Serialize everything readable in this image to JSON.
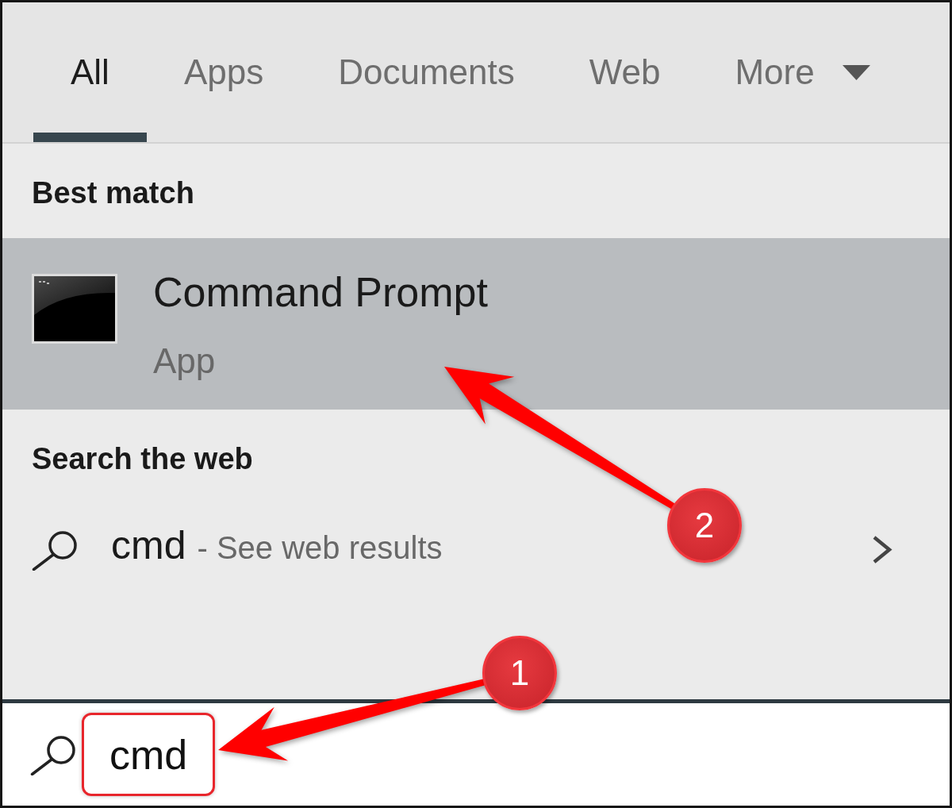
{
  "tabs": [
    {
      "label": "All",
      "selected": true
    },
    {
      "label": "Apps",
      "selected": false
    },
    {
      "label": "Documents",
      "selected": false
    },
    {
      "label": "Web",
      "selected": false
    },
    {
      "label": "More",
      "selected": false,
      "dropdown": true
    }
  ],
  "sections": [
    {
      "heading": "Best match",
      "results": [
        {
          "kind": "app",
          "title": "Command Prompt",
          "subtitle": "App",
          "selected": true,
          "callout": "2"
        }
      ]
    },
    {
      "heading": "Search the web",
      "results": [
        {
          "kind": "web",
          "query": "cmd",
          "hint": "- See web results",
          "selected": false
        }
      ]
    }
  ],
  "search_box": {
    "value": "cmd",
    "highlighted": true,
    "callout": "1"
  }
}
